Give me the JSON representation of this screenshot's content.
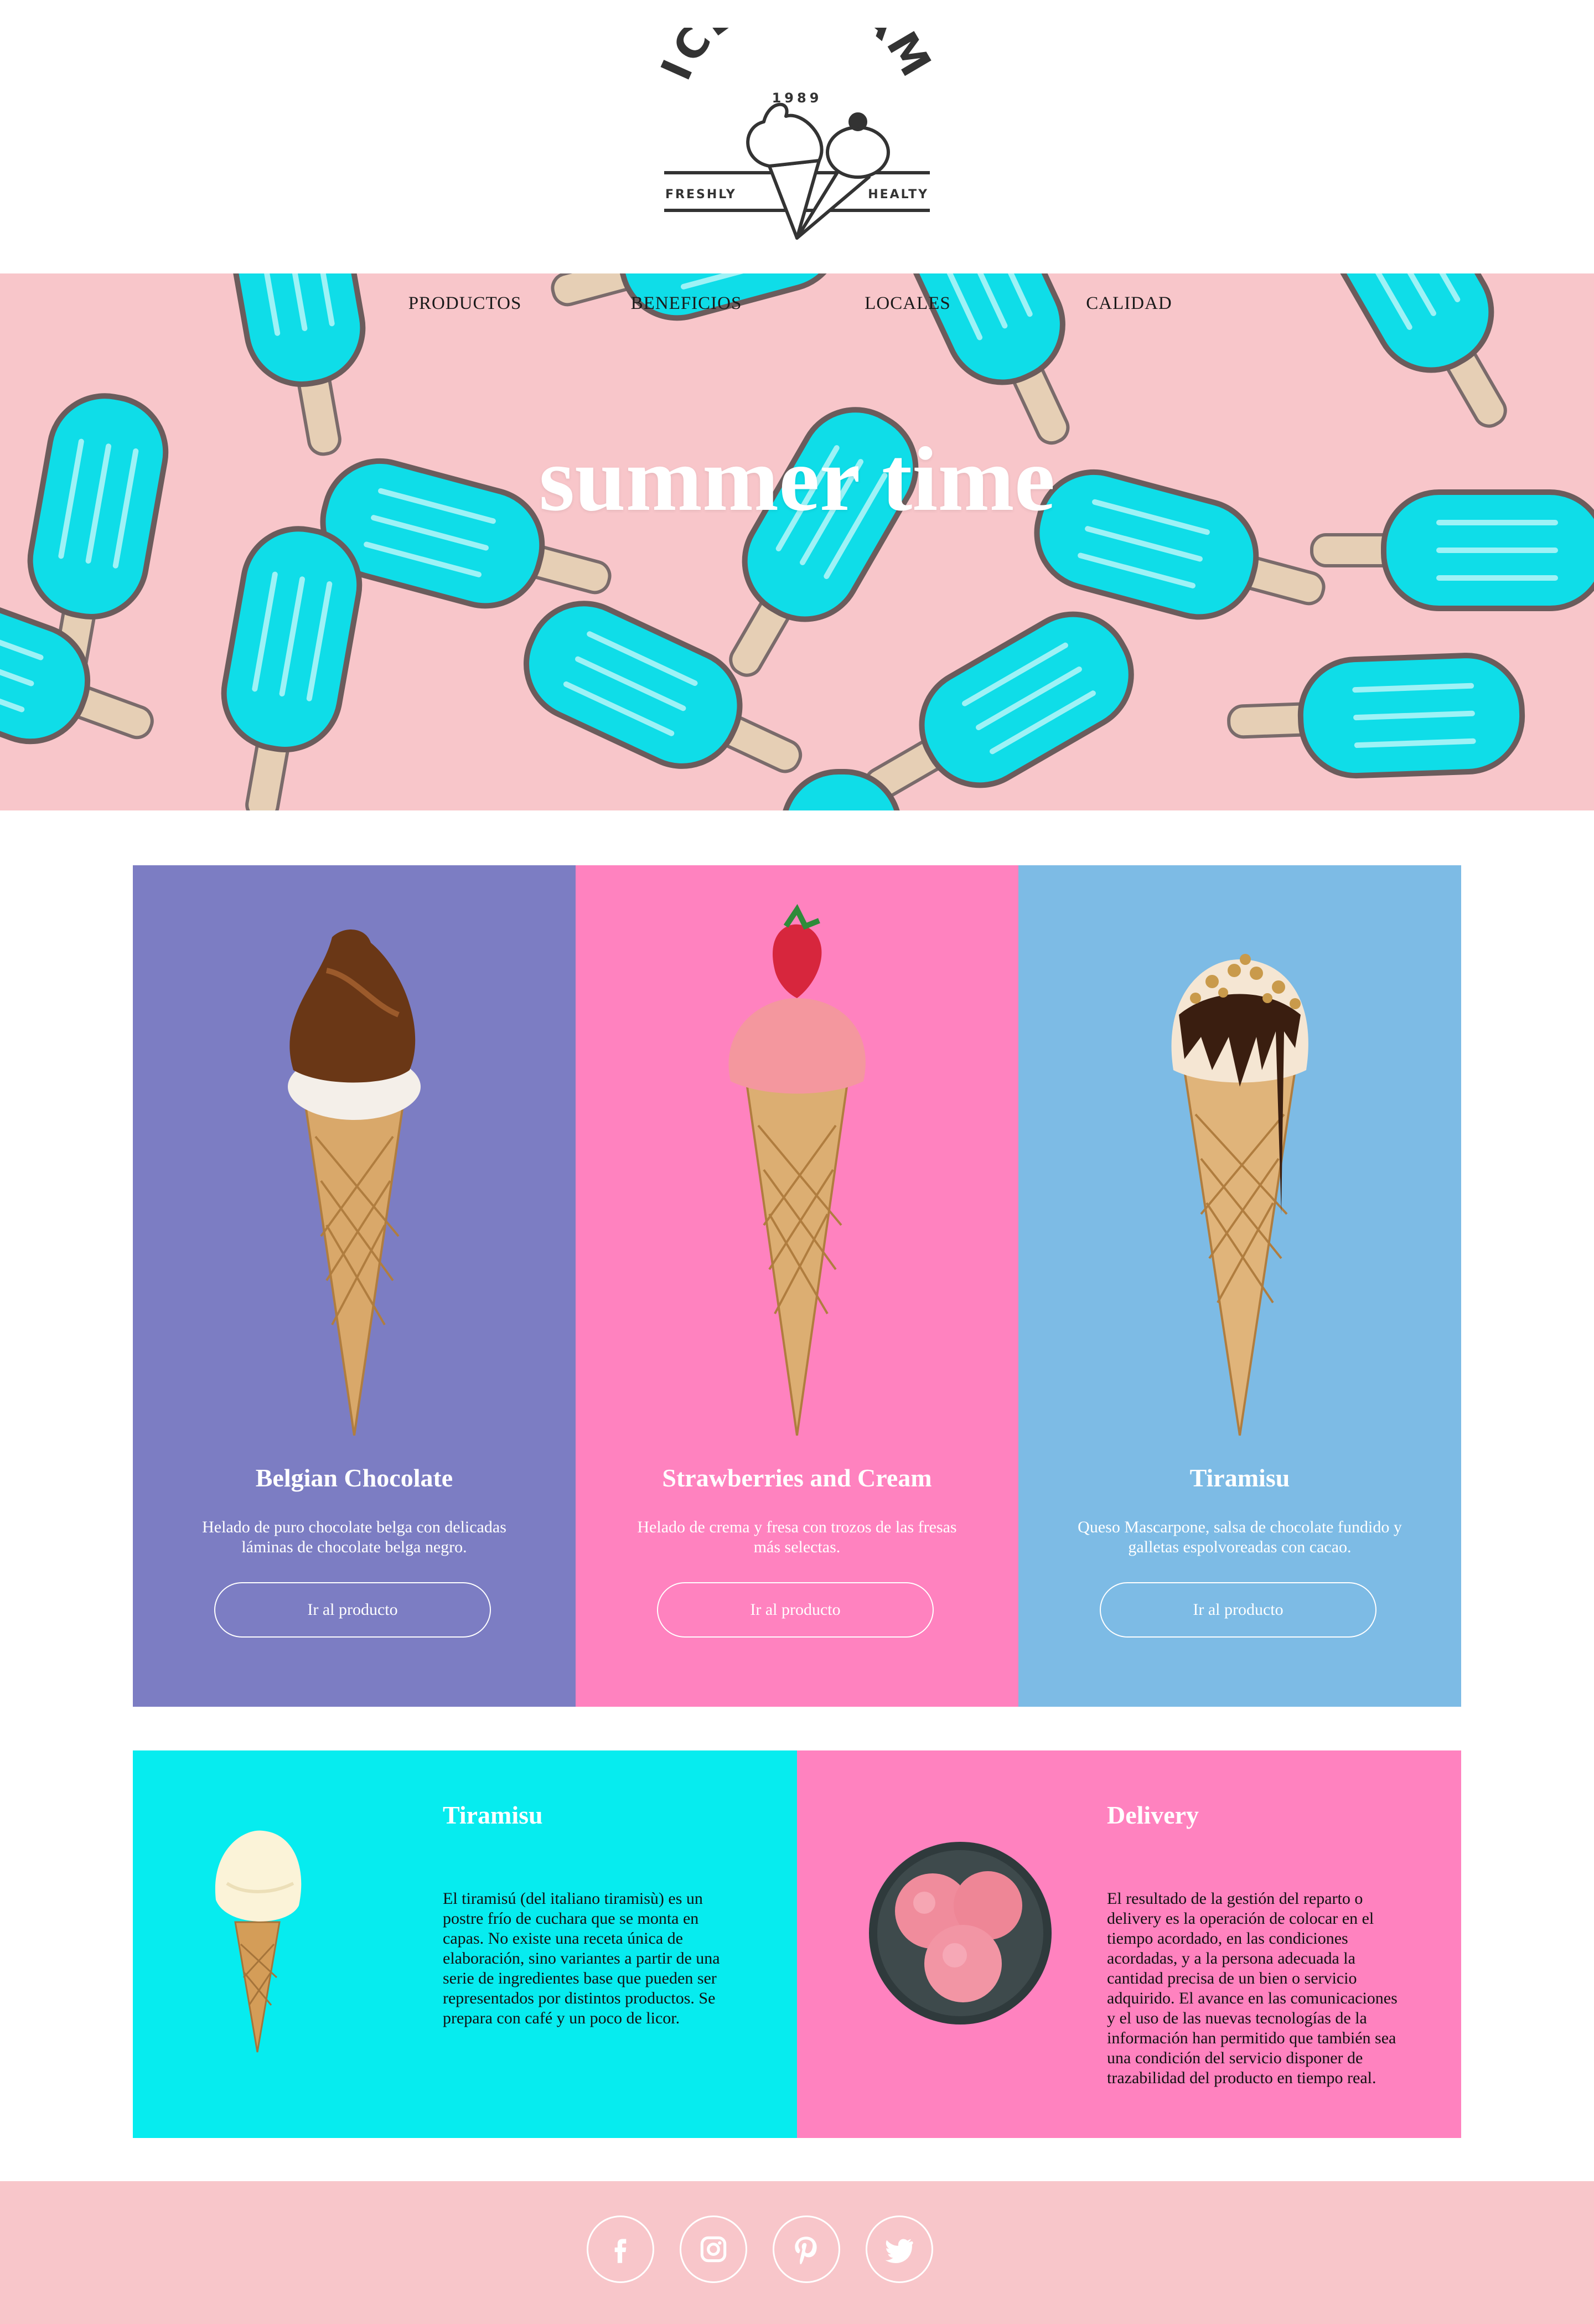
{
  "brand": {
    "logo_text": "ICE CREAM",
    "year": "1989",
    "left_tag": "FRESHLY",
    "right_tag": "HEALTY"
  },
  "nav": {
    "items": [
      "PRODUCTOS",
      "BENEFICIOS",
      "LOCALES",
      "CALIDAD"
    ]
  },
  "hero": {
    "title": "summer time",
    "background": "#f8c6ca",
    "popsicle_color": "#0fdde8"
  },
  "products": [
    {
      "name": "Belgian Chocolate",
      "description": "Helado de puro chocolate belga con delicadas láminas de chocolate belga negro.",
      "button": "Ir al producto",
      "bg": "#7c7dc3",
      "icon": "chocolate-ice-cream-cone"
    },
    {
      "name": "Strawberries and Cream",
      "description": "Helado de crema y fresa con trozos de las fresas más selectas.",
      "button": "Ir al producto",
      "bg": "#ff82bf",
      "icon": "strawberry-ice-cream-cone"
    },
    {
      "name": "Tiramisu",
      "description": "Queso Mascarpone, salsa de chocolate fundido y galletas espolvoreadas con cacao.",
      "button": "Ir al producto",
      "bg": "#7dbbe5",
      "icon": "tiramisu-ice-cream-cone"
    }
  ],
  "info": [
    {
      "title": "Tiramisu",
      "text": "El tiramisú (del italiano tiramisù) es un postre frío de cuchara que se monta en capas. No existe una receta única de elaboración, sino variantes a partir de una serie de ingredientes base que pueden ser representados por distintos productos. Se prepara con café y un poco de licor.",
      "bg": "#06ecef",
      "icon": "vanilla-cone"
    },
    {
      "title": "Delivery",
      "text": "El resultado de la gestión del reparto o delivery es la operación de colocar en el tiempo acordado, en las condiciones acordadas, y a la persona adecuada la cantidad precisa de un bien o servicio adquirido. El avance en las comunicaciones y el uso de las nuevas tecnologías de la información han permitido que también sea una condición del servicio disponer de trazabilidad del producto en tiempo real.",
      "bg": "#ff82bf",
      "icon": "ice-cream-bowl"
    }
  ],
  "footer": {
    "bg": "#f8c6ca",
    "social": [
      "facebook-icon",
      "instagram-icon",
      "pinterest-icon",
      "twitter-icon"
    ]
  }
}
